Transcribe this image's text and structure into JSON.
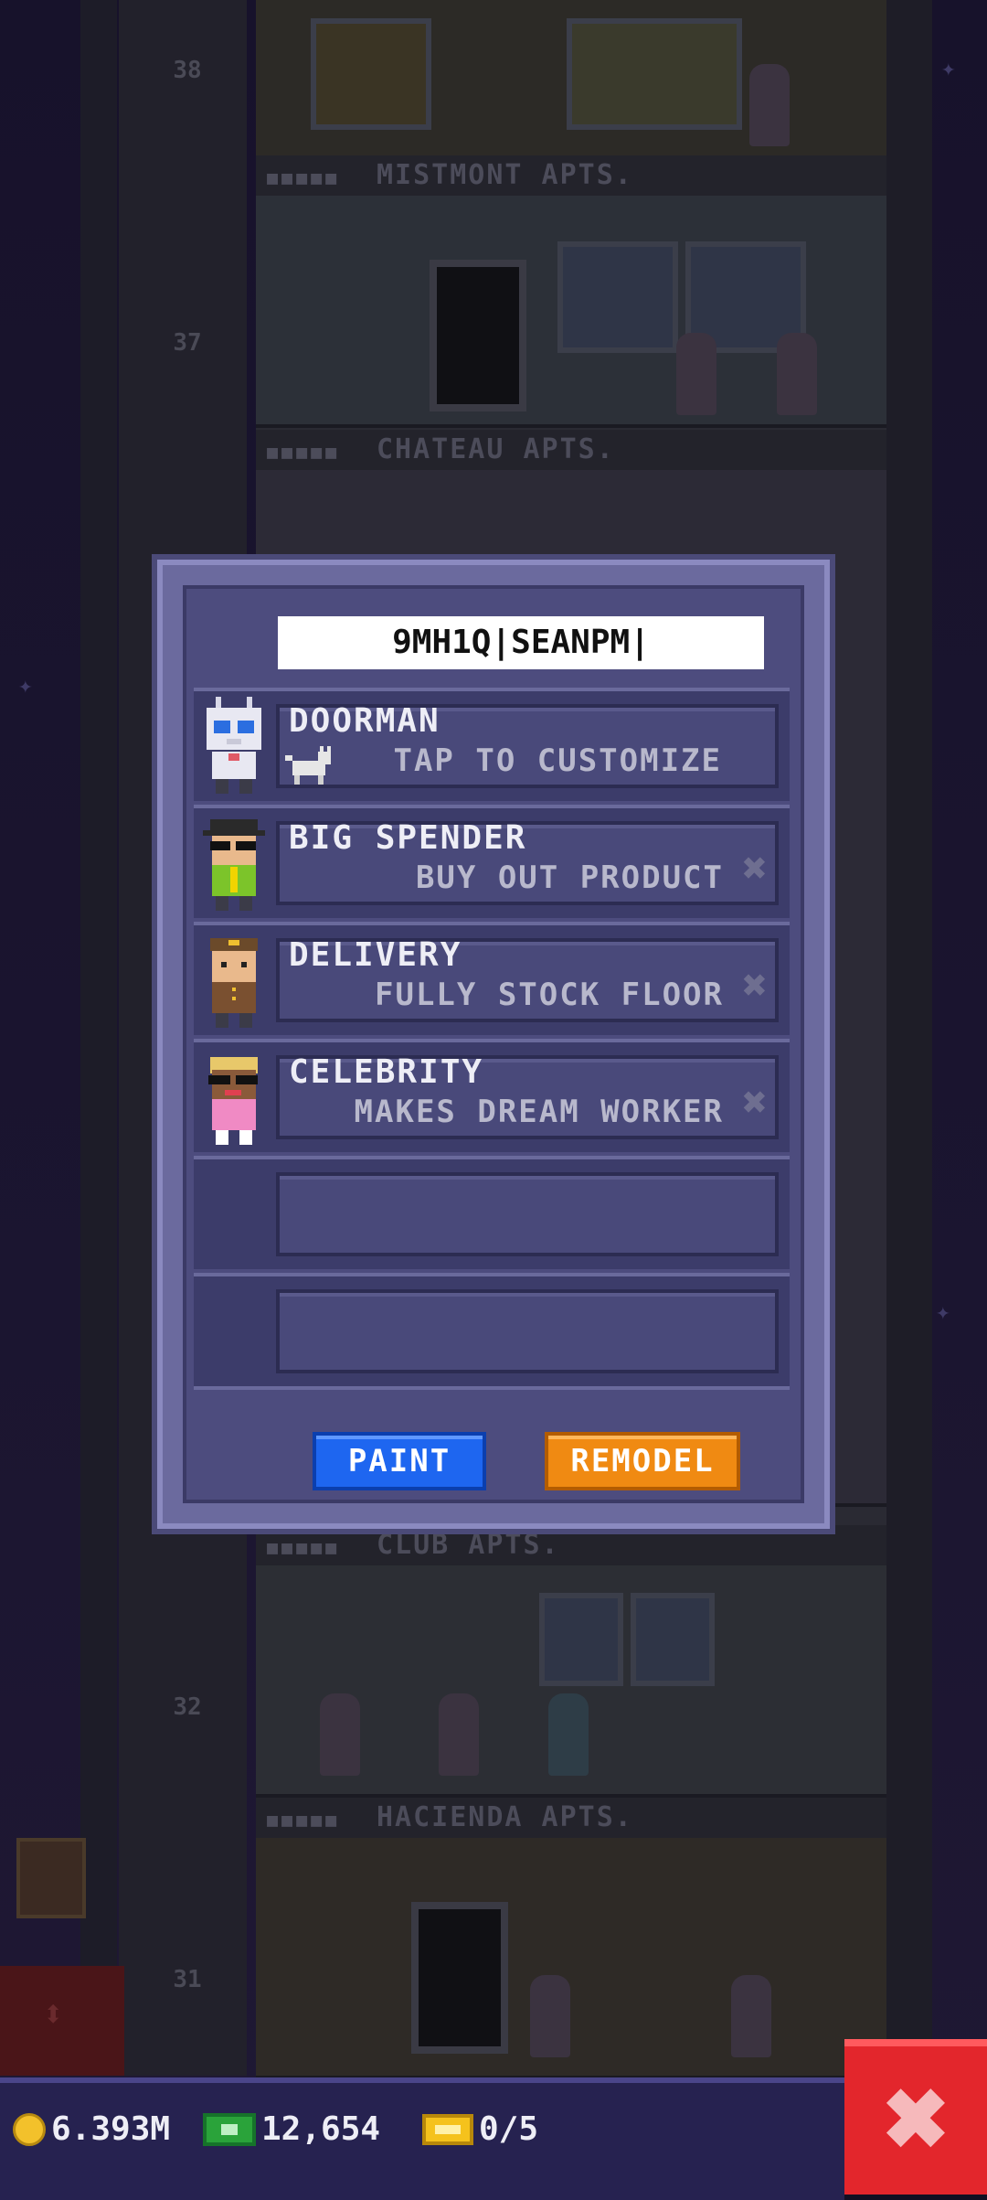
{
  "background": {
    "floor_labels": [
      "MISTMONT APTS.",
      "CHATEAU APTS.",
      "CLUB APTS.",
      "HACIENDA APTS."
    ],
    "floor_numbers": [
      "38",
      "37",
      "32",
      "31"
    ]
  },
  "dialog": {
    "name_value": "9MH1Q|SEANPM|",
    "rows": [
      {
        "title": "DOORMAN",
        "subtitle": "TAP TO CUSTOMIZE",
        "unavailable": false
      },
      {
        "title": "BIG SPENDER",
        "subtitle": "BUY OUT PRODUCT",
        "unavailable": true,
        "mark": "✖"
      },
      {
        "title": "DELIVERY",
        "subtitle": "FULLY STOCK FLOOR",
        "unavailable": true,
        "mark": "✖"
      },
      {
        "title": "CELEBRITY",
        "subtitle": "MAKES DREAM WORKER",
        "unavailable": true,
        "mark": "✖"
      },
      {
        "title": "",
        "subtitle": ""
      },
      {
        "title": "",
        "subtitle": ""
      }
    ],
    "paint_label": "PAINT",
    "remodel_label": "REMODEL"
  },
  "bottom_bar": {
    "coins": "6.393M",
    "bux": "12,654",
    "tickets": "0/5",
    "close_symbol": "✖"
  },
  "colors": {
    "paint": "#1e66f0",
    "remodel": "#f08a12",
    "close": "#e3262c"
  }
}
